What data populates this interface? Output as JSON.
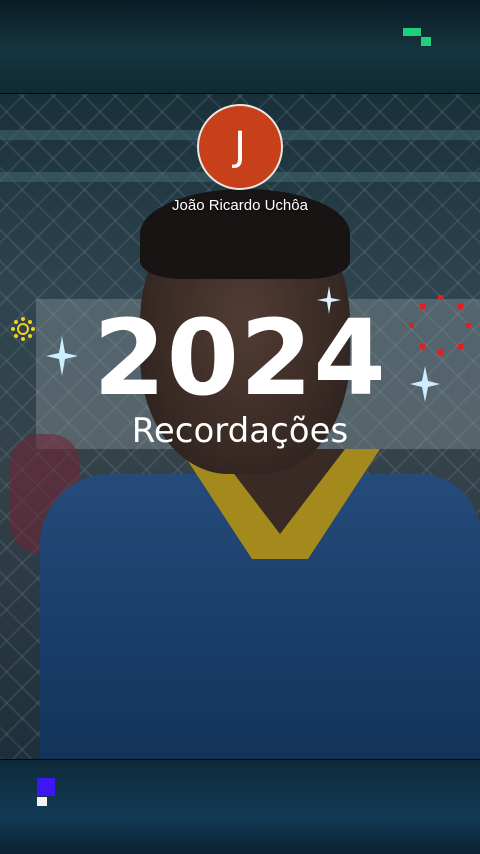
{
  "profile": {
    "initial": "J",
    "name": "João Ricardo Uchôa",
    "avatar_color": "#c8401a"
  },
  "headline": {
    "year": "2024",
    "subtitle": "Recordações"
  },
  "colors": {
    "shirt": "#1e4a82",
    "collar": "#d8b21e",
    "accent_green": "#1fd07a",
    "accent_purple": "#3d17f2"
  },
  "icons": [
    "sparkle-icon",
    "confetti-icon",
    "pixel-logo-icon"
  ]
}
